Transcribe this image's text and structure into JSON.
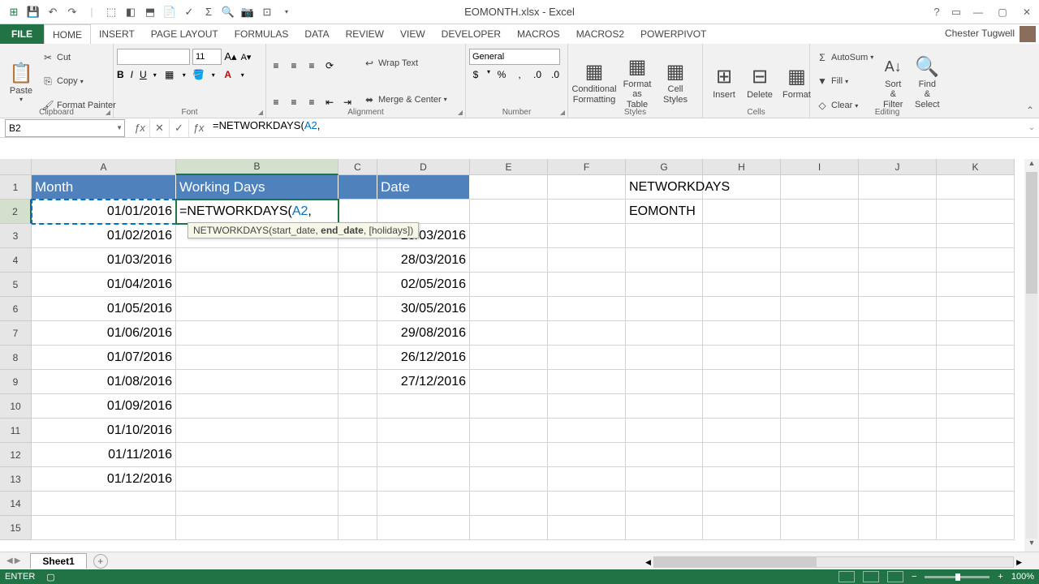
{
  "title": "EOMONTH.xlsx - Excel",
  "user": "Chester Tugwell",
  "tabs": [
    "HOME",
    "INSERT",
    "PAGE LAYOUT",
    "FORMULAS",
    "DATA",
    "REVIEW",
    "VIEW",
    "DEVELOPER",
    "MACROS",
    "MACROS2",
    "POWERPIVOT"
  ],
  "file_tab": "FILE",
  "clipboard": {
    "paste": "Paste",
    "cut": "Cut",
    "copy": "Copy",
    "fp": "Format Painter",
    "label": "Clipboard"
  },
  "font": {
    "size": "11",
    "bold": "B",
    "italic": "I",
    "underline": "U",
    "label": "Font"
  },
  "alignment": {
    "wrap": "Wrap Text",
    "merge": "Merge & Center",
    "label": "Alignment"
  },
  "number": {
    "format": "General",
    "label": "Number"
  },
  "styles": {
    "cf": "Conditional Formatting",
    "fat": "Format as Table",
    "cs": "Cell Styles",
    "label": "Styles"
  },
  "cells": {
    "insert": "Insert",
    "delete": "Delete",
    "format": "Format",
    "label": "Cells"
  },
  "editing": {
    "autosum": "AutoSum",
    "fill": "Fill",
    "clear": "Clear",
    "sort": "Sort & Filter",
    "find": "Find & Select",
    "label": "Editing"
  },
  "name_box": "B2",
  "formula": {
    "prefix": "=NETWORKDAYS(",
    "ref": "A2",
    "suffix": ","
  },
  "tooltip": {
    "fn": "NETWORKDAYS(start_date, ",
    "bold": "end_date",
    "rest": ", [holidays])"
  },
  "columns": [
    "A",
    "B",
    "C",
    "D",
    "E",
    "F",
    "G",
    "H",
    "I",
    "J",
    "K"
  ],
  "headers": {
    "A": "Month",
    "B": "Working Days",
    "D": "Date"
  },
  "dataA": [
    "01/01/2016",
    "01/02/2016",
    "01/03/2016",
    "01/04/2016",
    "01/05/2016",
    "01/06/2016",
    "01/07/2016",
    "01/08/2016",
    "01/09/2016",
    "01/10/2016",
    "01/11/2016",
    "01/12/2016"
  ],
  "dataD": [
    "",
    "25/03/2016",
    "28/03/2016",
    "02/05/2016",
    "30/05/2016",
    "29/08/2016",
    "26/12/2016",
    "27/12/2016"
  ],
  "g1": "NETWORKDAYS",
  "g2": "EOMONTH",
  "sheet": "Sheet1",
  "status": "ENTER",
  "zoom": "100%"
}
